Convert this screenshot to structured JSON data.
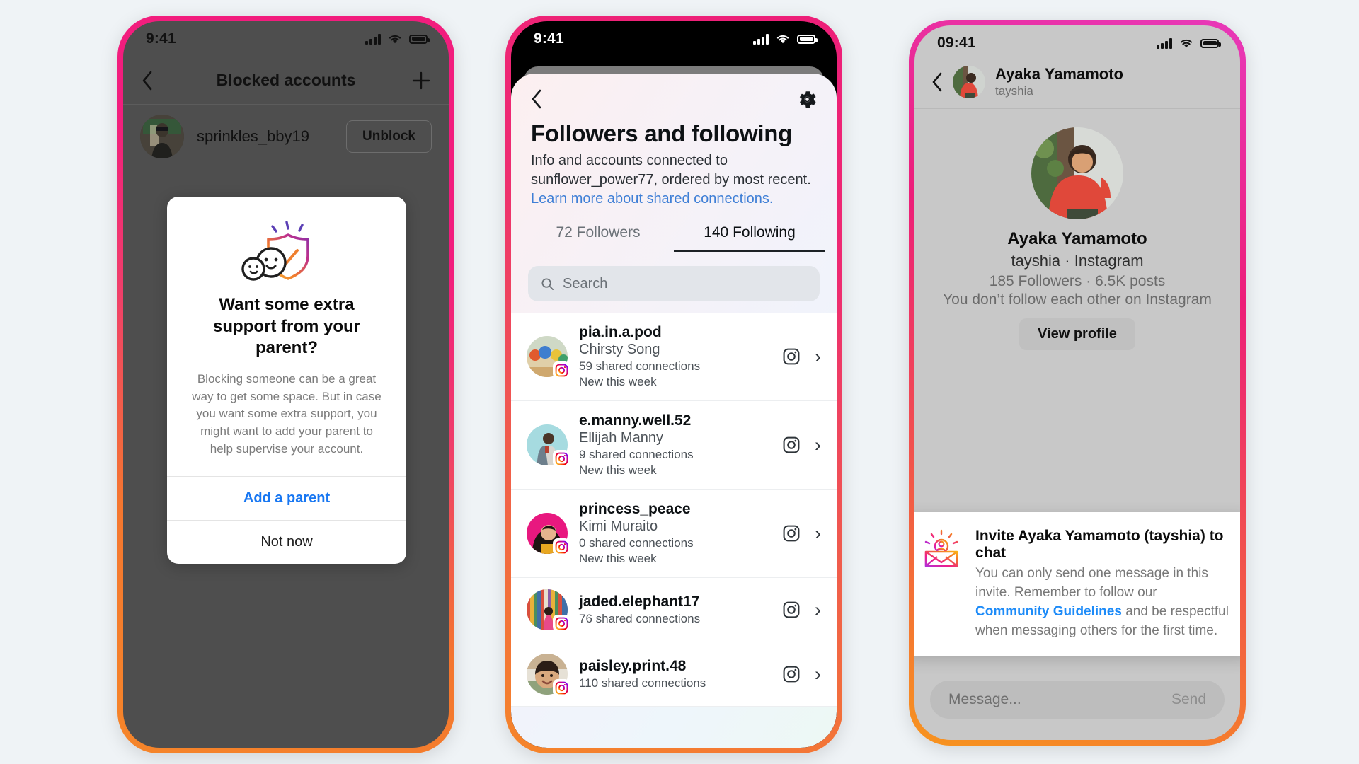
{
  "background_color": "#eff3f6",
  "phones": {
    "blocked_accounts": {
      "status_bar": {
        "time": "9:41"
      },
      "nav": {
        "back_icon": "chevron-left-icon",
        "title": "Blocked accounts",
        "add_icon": "plus-icon"
      },
      "blocked_row": {
        "username": "sprinkles_bby19",
        "action_label": "Unblock"
      },
      "modal": {
        "icon": "faces-shield-check-icon",
        "heading": "Want some extra support from your parent?",
        "body": "Blocking someone can be a great way to get some space. But in case you want some extra support, you might want to add your parent to help supervise your account.",
        "primary_label": "Add a parent",
        "primary_color": "#1877f2",
        "secondary_label": "Not now"
      }
    },
    "followers_following": {
      "status_bar": {
        "time": "9:41"
      },
      "nav": {
        "back_icon": "chevron-left-icon",
        "settings_icon": "gear-icon"
      },
      "heading": "Followers and following",
      "subtitle": "Info and accounts connected to sunflower_power77, ordered by most recent.",
      "link": "Learn more about shared connections.",
      "link_color": "#3f7fd6",
      "tabs": [
        {
          "label": "72 Followers",
          "active": false
        },
        {
          "label": "140 Following",
          "active": true
        }
      ],
      "search": {
        "icon": "search-icon",
        "placeholder": "Search",
        "value": ""
      },
      "list": [
        {
          "username": "pia.in.a.pod",
          "full_name": "Chirsty Song",
          "shared": "59 shared connections",
          "recency": "New this week",
          "platform_icon": "instagram-icon",
          "chevron": "chevron-right-icon"
        },
        {
          "username": "e.manny.well.52",
          "full_name": "Ellijah Manny",
          "shared": "9 shared connections",
          "recency": "New this week",
          "platform_icon": "instagram-icon",
          "chevron": "chevron-right-icon"
        },
        {
          "username": "princess_peace",
          "full_name": "Kimi Muraito",
          "shared": "0 shared connections",
          "recency": "New this week",
          "platform_icon": "instagram-icon",
          "chevron": "chevron-right-icon"
        },
        {
          "username": "jaded.elephant17",
          "full_name": "",
          "shared": "76 shared connections",
          "recency": "",
          "platform_icon": "instagram-icon",
          "chevron": "chevron-right-icon"
        },
        {
          "username": "paisley.print.48",
          "full_name": "",
          "shared": "110 shared connections",
          "recency": "",
          "platform_icon": "instagram-icon",
          "chevron": "chevron-right-icon"
        }
      ]
    },
    "chat_invite": {
      "status_bar": {
        "time": "09:41"
      },
      "nav": {
        "back_icon": "chevron-left-icon",
        "name": "Ayaka Yamamoto",
        "username": "tayshia"
      },
      "profile": {
        "name": "Ayaka Yamamoto",
        "handle": "tayshia · Instagram",
        "stats": "185 Followers · 6.5K posts",
        "relationship": "You don’t follow each other on Instagram",
        "view_profile_label": "View profile"
      },
      "invite_card": {
        "icon": "invite-envelope-icon",
        "title": "Invite Ayaka Yamamoto (tayshia) to chat",
        "body_before": "You can only send one message in this invite. Remember to follow our ",
        "link": "Community Guidelines",
        "link_color": "#1d8bf8",
        "body_after": " and be respectful when messaging others for the first time."
      },
      "composer": {
        "placeholder": "Message...",
        "value": "",
        "send_label": "Send"
      }
    }
  }
}
